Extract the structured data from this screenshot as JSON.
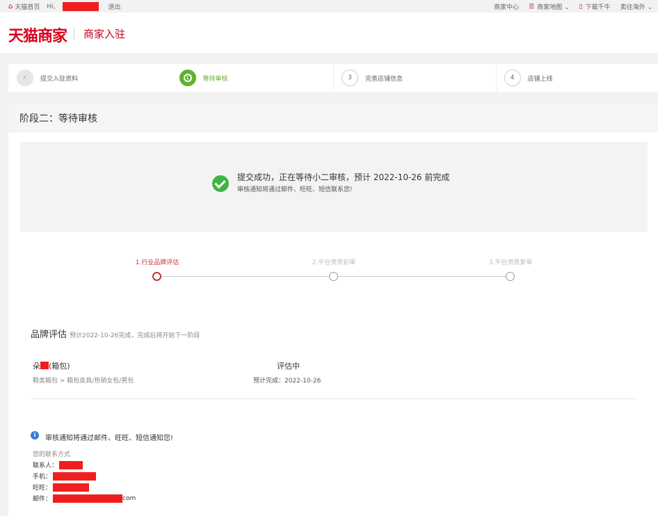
{
  "topbar": {
    "home_icon": "home-icon",
    "home_link": "天猫首页",
    "greeting": "Hi,",
    "logout": "退出",
    "merchant_center": "商家中心",
    "sitemap_icon": "list-icon",
    "sitemap": "商家地图",
    "download_icon": "phone-icon",
    "download": "下载千牛",
    "overseas": "卖往海外"
  },
  "header": {
    "logo": "天猫商家",
    "subtitle": "商家入驻"
  },
  "stepper": {
    "steps": [
      {
        "num": "✓",
        "label": "提交入驻资料",
        "state": "done"
      },
      {
        "num": "",
        "label": "等待审核",
        "state": "active"
      },
      {
        "num": "3",
        "label": "完善店铺信息",
        "state": "todo"
      },
      {
        "num": "4",
        "label": "店铺上线",
        "state": "todo"
      }
    ]
  },
  "panel": {
    "title": "阶段二：等待审核",
    "success_title": "提交成功，正在等待小二审核，预计 2022-10-26 前完成",
    "success_sub": "审核通知将通过邮件、旺旺、短信联系您!"
  },
  "timeline": {
    "stages": [
      {
        "label": "1.行业品牌评估",
        "state": "on"
      },
      {
        "label": "2.平台资质初审",
        "state": "off"
      },
      {
        "label": "3.平台资质复审",
        "state": "off"
      }
    ]
  },
  "brand": {
    "heading": "品牌评估",
    "heading_note": "预计2022-10-26完成，完成后将开始下一阶段",
    "name_prefix": "朵",
    "name_suffix": "(箱包)",
    "category": "鞋类箱包 > 箱包皮具/热销女包/男包",
    "status": "评估中",
    "eta": "预计完成：2022-10-26"
  },
  "notice": {
    "icon": "info-icon",
    "text": "审核通知将通过邮件、旺旺、短信通知您!",
    "contact_title": "您的联系方式",
    "contact_label": "联系人：",
    "phone_label": "手机：",
    "wangwang_label": "旺旺：",
    "email_label": "邮件：",
    "email_suffix": "com"
  },
  "colors": {
    "brand_red": "#d9001b",
    "active_green": "#61b22f",
    "success_green": "#41b343",
    "timeline_red": "#c83232",
    "redaction": "#f01e1e"
  }
}
